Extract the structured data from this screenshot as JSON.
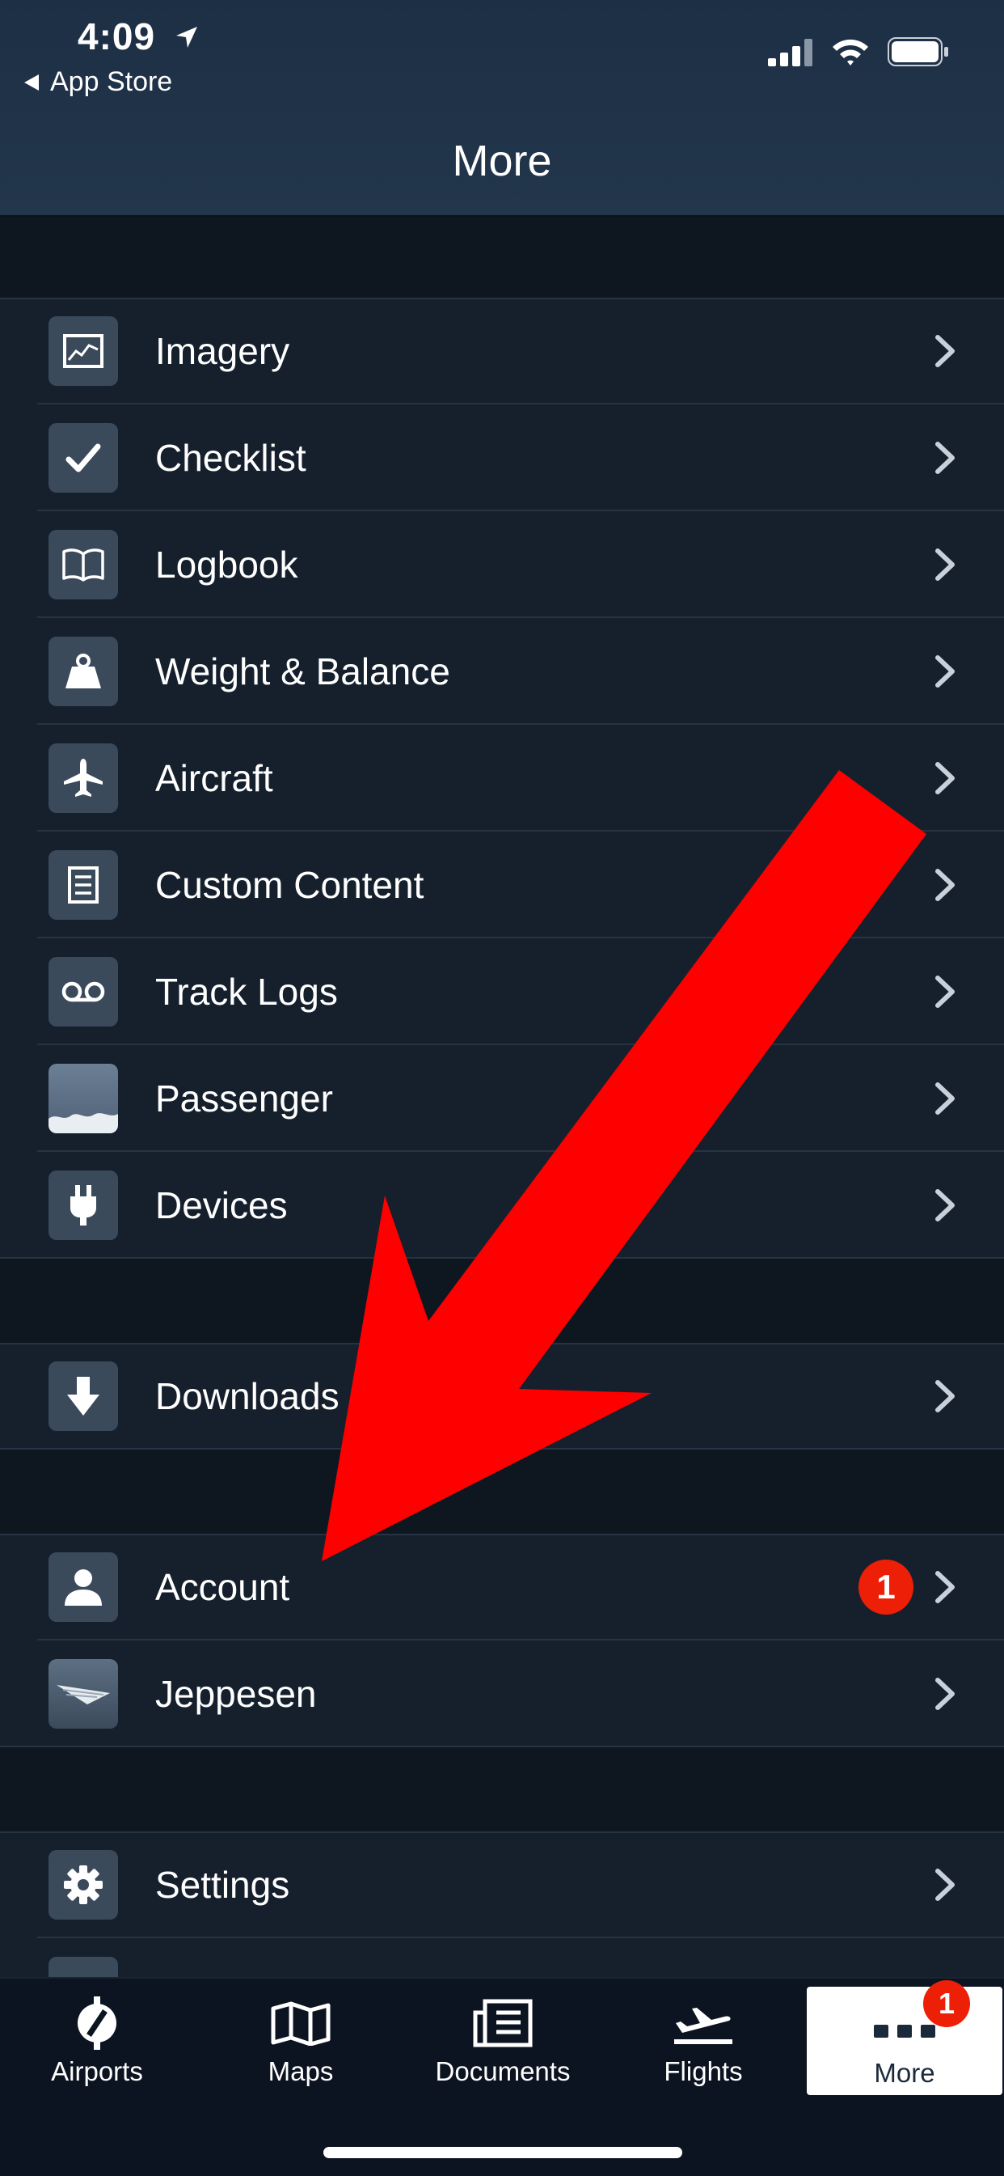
{
  "status_bar": {
    "time": "4:09",
    "back_label": "App Store"
  },
  "header": {
    "title": "More"
  },
  "sections": [
    {
      "items": [
        {
          "label": "Imagery",
          "icon": "imagery-icon"
        },
        {
          "label": "Checklist",
          "icon": "checkmark-icon"
        },
        {
          "label": "Logbook",
          "icon": "book-icon"
        },
        {
          "label": "Weight & Balance",
          "icon": "weight-icon"
        },
        {
          "label": "Aircraft",
          "icon": "airplane-icon"
        },
        {
          "label": "Custom Content",
          "icon": "document-icon"
        },
        {
          "label": "Track Logs",
          "icon": "voicemail-icon"
        },
        {
          "label": "Passenger",
          "icon": "passenger-view-icon"
        },
        {
          "label": "Devices",
          "icon": "plug-icon"
        }
      ]
    },
    {
      "items": [
        {
          "label": "Downloads",
          "icon": "download-arrow-icon"
        }
      ]
    },
    {
      "items": [
        {
          "label": "Account",
          "icon": "person-icon",
          "badge": "1"
        },
        {
          "label": "Jeppesen",
          "icon": "jeppesen-logo-icon"
        }
      ]
    },
    {
      "items": [
        {
          "label": "Settings",
          "icon": "gear-icon"
        }
      ]
    }
  ],
  "tabbar": {
    "tabs": [
      {
        "label": "Airports",
        "icon": "airport-icon"
      },
      {
        "label": "Maps",
        "icon": "map-icon"
      },
      {
        "label": "Documents",
        "icon": "documents-icon"
      },
      {
        "label": "Flights",
        "icon": "takeoff-icon"
      },
      {
        "label": "More",
        "icon": "more-dots-icon",
        "badge": "1",
        "active": true
      }
    ]
  },
  "colors": {
    "background": "#0f1823",
    "row": "#16202d",
    "icon_tile": "#3b4a5b",
    "badge": "#ee1f07",
    "annotation_arrow": "#ff0000"
  }
}
